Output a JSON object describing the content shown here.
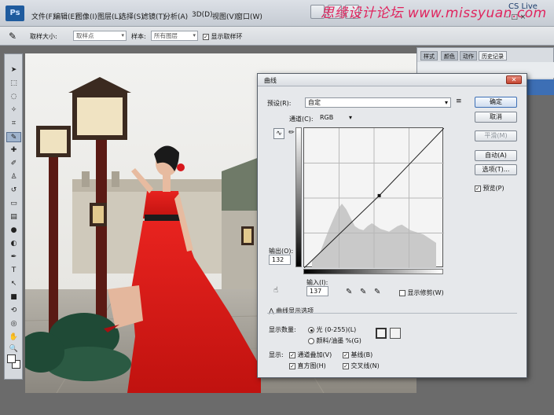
{
  "menubar": {
    "logo": "Ps",
    "menus": [
      "文件(F)",
      "编辑(E)",
      "图像(I)",
      "图层(L)",
      "选择(S)",
      "滤镜(T)",
      "分析(A)",
      "3D(D)",
      "视图(V)",
      "窗口(W)"
    ],
    "watermark": "思缘设计论坛 www.missyuan.com",
    "watermark_sub": "www.missyuan.com",
    "cs_label": "CS Live",
    "win_controls": "– □ ×"
  },
  "options": {
    "sample_size_label": "取样大小:",
    "sample_size_value": "取样点",
    "sample_label": "样本:",
    "sample_value": "所有图层",
    "show_ring_label": "显示取样环"
  },
  "history": {
    "tabs": [
      "历史记录",
      "动作",
      "颜色",
      "样式"
    ]
  },
  "curves": {
    "title": "曲线",
    "preset_label": "预设(R):",
    "preset_value": "自定",
    "channel_label": "通道(C):",
    "channel_value": "RGB",
    "output_label": "输出(O):",
    "output_value": "132",
    "input_label": "输入(I):",
    "input_value": "137",
    "show_clipping_label": "显示修剪(W)",
    "display_options_label": "曲线显示选项",
    "show_amount_label": "显示数量:",
    "light_label": "光 (0-255)(L)",
    "pigment_label": "颜料/油墨 %(G)",
    "show_label": "显示:",
    "channel_overlay_label": "通道叠加(V)",
    "baseline_label": "基线(B)",
    "histogram_label": "直方图(H)",
    "intersection_label": "交叉线(N)",
    "buttons": {
      "ok": "确定",
      "cancel": "取消",
      "smooth": "平滑(M)",
      "auto": "自动(A)",
      "options": "选项(T)...",
      "preview": "预览(P)"
    },
    "curve_point": {
      "input": 137,
      "output": 132
    }
  }
}
